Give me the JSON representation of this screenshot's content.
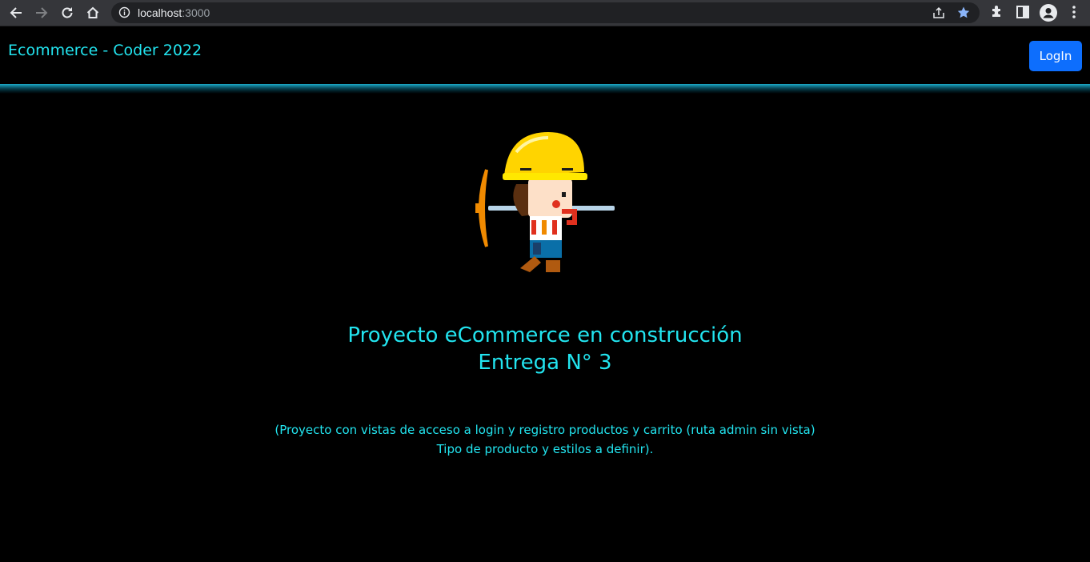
{
  "browser": {
    "url_host": "localhost",
    "url_port": ":3000",
    "icons": [
      "back-icon",
      "forward-icon",
      "reload-icon",
      "home-icon",
      "info-icon",
      "share-icon",
      "star-icon",
      "extensions-icon",
      "side-panel-icon",
      "profile-icon",
      "menu-icon"
    ]
  },
  "header": {
    "brand": "Ecommerce - Coder 2022",
    "login_label": "LogIn"
  },
  "main": {
    "illustration": "construction-worker-with-pickaxe",
    "title_line1": "Proyecto eCommerce en construcción",
    "title_line2": "Entrega N° 3",
    "desc_line1": "(Proyecto con vistas de acceso a login y registro productos y carrito (ruta admin sin vista)",
    "desc_line2": "Tipo de producto y estilos a definir)."
  },
  "colors": {
    "accent": "#22e4ef",
    "button": "#0d6efd",
    "background": "#000000"
  }
}
